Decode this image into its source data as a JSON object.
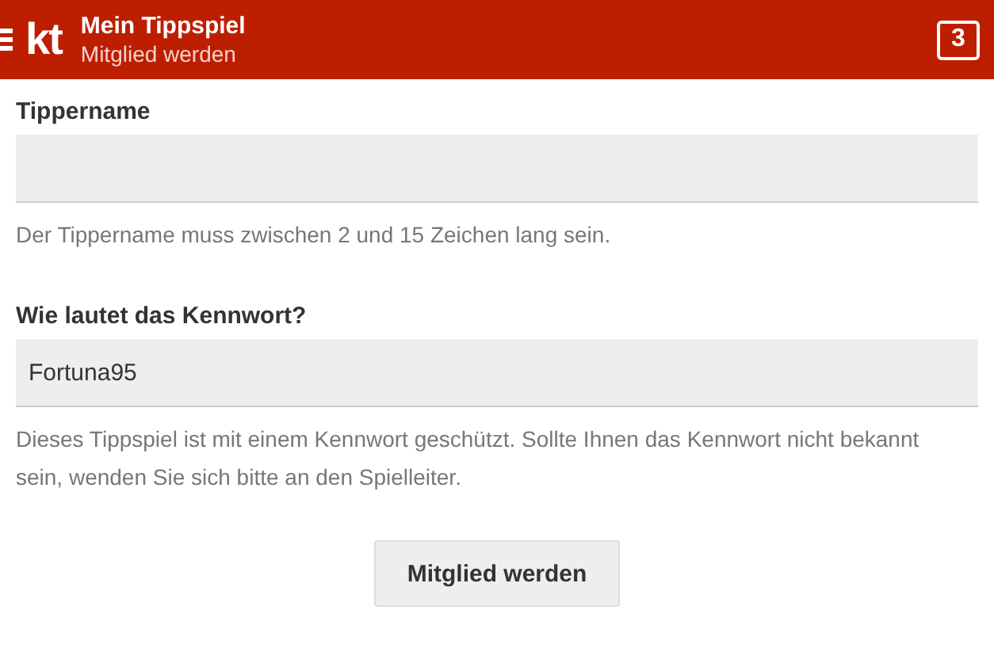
{
  "header": {
    "logo": "kt",
    "title": "Mein Tippspiel",
    "subtitle": "Mitglied werden",
    "badge": "3"
  },
  "fields": [
    {
      "label": "Tippername",
      "help": "Der Tippername muss zwischen 2 und 15 Zeichen lang sein."
    },
    {
      "label": "Wie lautet das Kennwort?",
      "value": "Fortuna95",
      "help": "Dieses Tippspiel ist mit einem Kennwort geschützt. Sollte Ihnen das Kennwort nicht bekannt sein, wenden Sie sich bitte an den Spielleiter."
    }
  ],
  "submit": "Mitglied werden"
}
